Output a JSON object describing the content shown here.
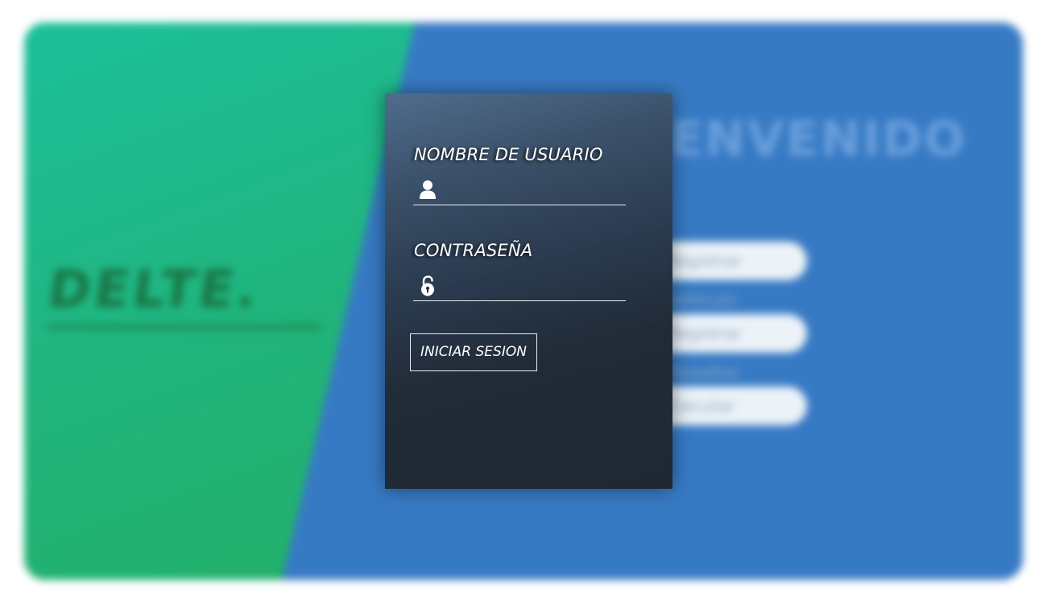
{
  "background": {
    "logo_text": "DELTE.",
    "welcome_text": "BIENVENIDO",
    "pills": [
      "Registrar vehiculo",
      "Registrar Pasadizo",
      "Ejecutar"
    ],
    "colors": {
      "green": "#22b46c",
      "blue": "#377ac4"
    }
  },
  "login": {
    "username": {
      "label": "NOMBRE DE USUARIO",
      "icon": "user-icon",
      "value": ""
    },
    "password": {
      "label": "CONTRASEÑA",
      "icon": "lock-icon",
      "value": ""
    },
    "submit_label": "INICIAR SESION"
  }
}
